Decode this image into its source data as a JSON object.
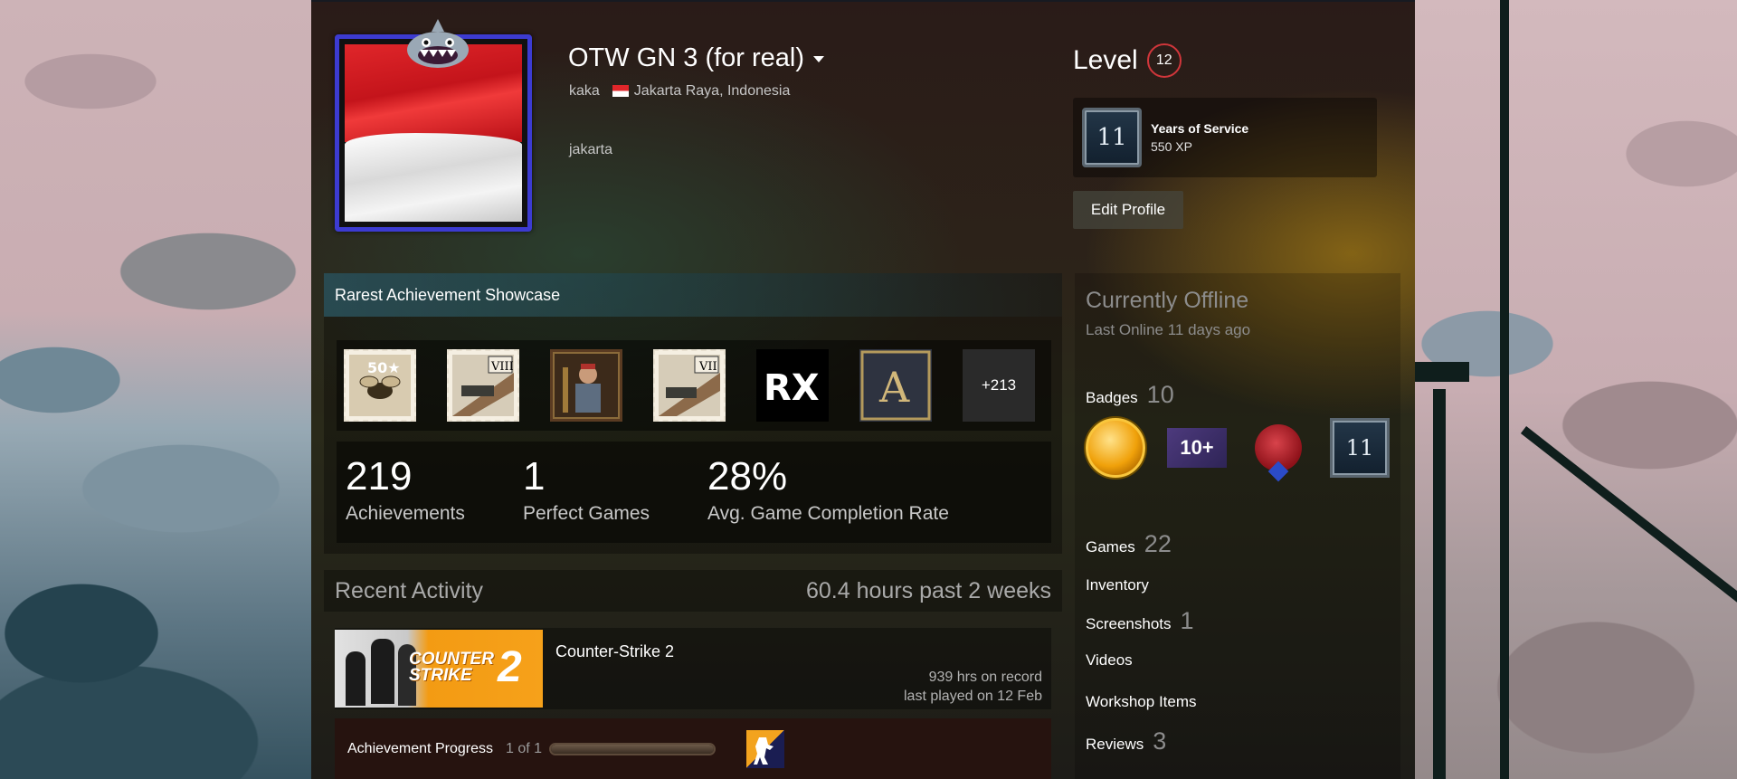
{
  "profile": {
    "persona_name": "OTW GN 3 (for real)",
    "real_name": "kaka",
    "location": "Jakarta Raya, Indonesia",
    "summary": "jakarta",
    "frame_color": "#3c3bd1"
  },
  "level": {
    "label": "Level",
    "value": "12"
  },
  "featured_badge": {
    "icon_text": "11",
    "title": "Years of Service",
    "xp": "550 XP"
  },
  "edit_profile_label": "Edit Profile",
  "showcase": {
    "title": "Rarest Achievement Showcase",
    "icons": [
      "wasp-50-stamp-icon",
      "viii-tank-stamp-icon",
      "knight-portrait-icon",
      "vii-tank-stamp-icon",
      "rx-logo-icon",
      "ornate-a-icon"
    ],
    "more_label": "+213",
    "stats": [
      {
        "value": "219",
        "label": "Achievements"
      },
      {
        "value": "1",
        "label": "Perfect Games"
      },
      {
        "value": "28%",
        "label": "Avg. Game Completion Rate"
      }
    ]
  },
  "recent_activity": {
    "title": "Recent Activity",
    "hours_summary": "60.4 hours past 2 weeks",
    "game": {
      "name": "Counter-Strike 2",
      "capsule_text_1": "COUNTER",
      "capsule_text_2": "STRIKE",
      "capsule_text_3": "2",
      "hours_on_record": "939 hrs on record",
      "last_played": "last played on 12 Feb"
    },
    "achievement_progress": {
      "label": "Achievement Progress",
      "count": "1 of 1",
      "fraction": 1.0
    }
  },
  "sidebar": {
    "status": "Currently Offline",
    "last_online": "Last Online 11 days ago",
    "badges": {
      "label": "Badges",
      "count": "10",
      "items": [
        "gold-coin-icon",
        "ten-plus-icon",
        "wax-seal-icon",
        "years-of-service-icon"
      ],
      "yos_text": "11",
      "tenplus_text": "10+"
    },
    "games": {
      "label": "Games",
      "count": "22"
    },
    "inventory": {
      "label": "Inventory"
    },
    "screenshots": {
      "label": "Screenshots",
      "count": "1"
    },
    "videos": {
      "label": "Videos"
    },
    "workshop": {
      "label": "Workshop Items"
    },
    "reviews": {
      "label": "Reviews",
      "count": "3"
    }
  }
}
